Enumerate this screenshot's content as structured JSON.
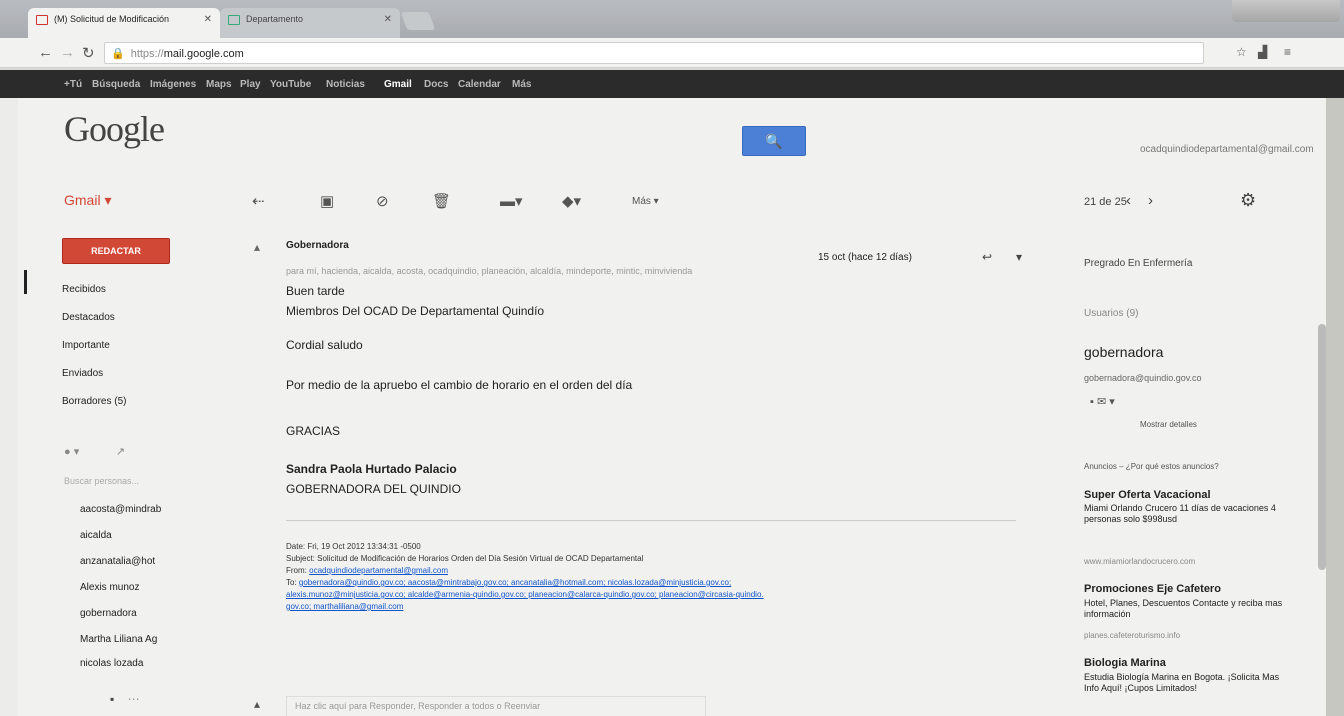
{
  "browser": {
    "tabs": [
      {
        "label": "(M) Solicitud de Modificación",
        "active": true
      },
      {
        "label": "Departamento",
        "active": false
      }
    ],
    "url_scheme": "https://",
    "url_domain": "mail.google.com"
  },
  "gbar": {
    "items": [
      "+Tú",
      "Búsqueda",
      "Imágenes",
      "Maps",
      "Play",
      "YouTube",
      "Noticias",
      "Gmail",
      "Docs",
      "Calendar",
      "Más"
    ],
    "active": "Gmail"
  },
  "header": {
    "logo": "Google",
    "account": "ocadquindiodepartamental@gmail.com"
  },
  "toolbar": {
    "gmail_menu": "Gmail",
    "more_label": "Más",
    "pager": "21 de 25"
  },
  "sidebar": {
    "compose_label": "REDACTAR",
    "items": [
      {
        "label": "Recibidos"
      },
      {
        "label": "Destacados"
      },
      {
        "label": "Importante"
      },
      {
        "label": "Enviados"
      },
      {
        "label": "Borradores (5)"
      }
    ],
    "chat_status": "Buscar personas...",
    "contacts": [
      "aacosta@mindrab",
      "aicalda",
      "anzanatalia@hot",
      "Alexis munoz",
      "gobernadora",
      "Martha Liliana Ag",
      "nicolas lozada"
    ]
  },
  "message": {
    "sender": "Gobernadora",
    "date": "15 oct (hace 12 días)",
    "recipients": "para mí, hacienda, aicalda, acosta, ocadquindio, planeación, alcaldía, mindeporte, mintic, minvivienda",
    "greeting": "Buen tarde",
    "to_line": "Miembros Del OCAD De Departamental Quindío",
    "salutation": "Cordial saludo",
    "body": "Por medio de la apruebo el cambio de horario  en el orden del día",
    "thanks": "GRACIAS",
    "signature_name": "Sandra Paola Hurtado Palacio",
    "signature_title": "GOBERNADORA DEL QUINDIO",
    "quoted_date": "Date: Fri, 19 Oct 2012 13:34:31 -0500",
    "quoted_subject": "Subject: Solicitud de Modificación de Horarios Orden del Día  Sesión Virtual de OCAD Departamental",
    "quoted_from_label": "From:",
    "quoted_from": "ocadquindiodepartamental@gmail.com",
    "quoted_to_label": "To:",
    "quoted_to_1": "gobernadora@quindio.gov.co; aacosta@mintrabajo.gov.co; ancanatalia@hotmail.com; nicolas.lozada@minjusticia.gov.co;",
    "quoted_to_2": "alexis.munoz@minjusticia.gov.co; alcalde@armenia-quindio.gov.co; planeacion@calarca-quindio.gov.co; planeacion@circasia-quindio.",
    "quoted_to_3": "gov.co; marthaliliana@gmail.com",
    "reply_prompt": "Haz clic aquí para Responder, Responder a todos o Reenviar"
  },
  "right_panel": {
    "circle_label": "Pregrado En Enfermería",
    "users_label": "Usuarios (9)",
    "contact_name": "gobernadora",
    "contact_email": "gobernadora@quindio.gov.co",
    "show_details": "Mostrar detalles",
    "ads_label": "Anuncios – ¿Por qué estos anuncios?",
    "ads": [
      {
        "title": "Super Oferta Vacacional",
        "text": "Miami Orlando Crucero 11 días de vacaciones 4 personas solo $998usd",
        "url": "www.miamiorlandocrucero.com"
      },
      {
        "title": "Promociones Eje Cafetero",
        "text": "Hotel, Planes, Descuentos Contacte y reciba mas información",
        "url": "planes.cafeteroturismo.info"
      },
      {
        "title": "Biologia Marina",
        "text": "Estudia Biología Marina en Bogota. ¡Solicita Mas Info Aquí! ¡Cupos Limitados!",
        "url": ""
      }
    ]
  }
}
